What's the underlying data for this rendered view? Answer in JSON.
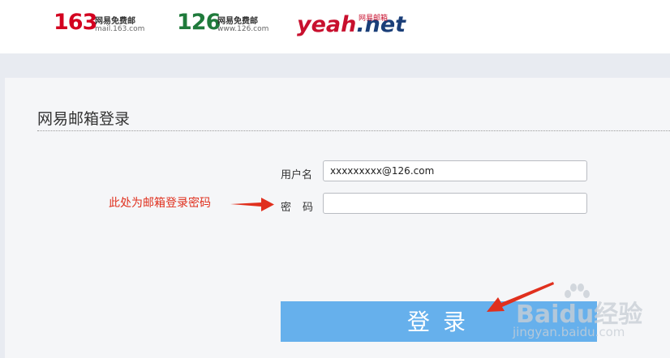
{
  "brands": {
    "mail163": {
      "number": "163",
      "name": "网易免费邮",
      "domain": "mail.163.com",
      "color": "#d3001f"
    },
    "mail126": {
      "number": "126",
      "name": "网易免费邮",
      "domain": "www.126.com",
      "color": "#1f7a3b"
    },
    "yeah": {
      "word": "yeah",
      "suffix": ".net",
      "tag": "网易邮箱",
      "color": "#c8102e"
    }
  },
  "login": {
    "title": "网易邮箱登录",
    "username_label": "用户名",
    "username_value": "xxxxxxxxx@126.com",
    "password_label": "密码",
    "password_value": "",
    "submit_label": "登录"
  },
  "annotation": {
    "text": "此处为邮箱登录密码",
    "color": "#e0301e"
  },
  "watermark": {
    "brand": "Baidu经验",
    "url": "jingyan.baidu.com"
  },
  "colors": {
    "button": "#66b0ec",
    "band": "#e8ebf1",
    "panel": "#f5f6f8"
  }
}
